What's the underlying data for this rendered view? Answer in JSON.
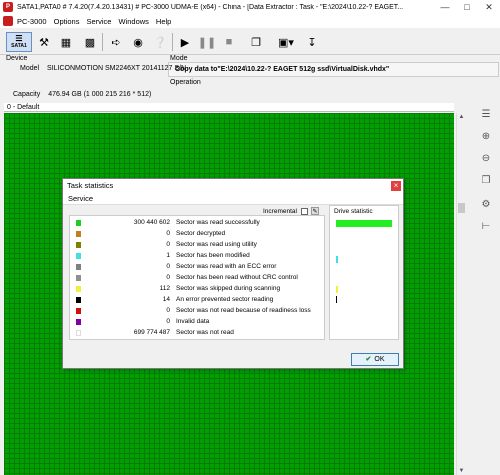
{
  "window": {
    "title": "SATA1,PATA0 # 7.4.20(7.4.20.13431) # PC-3000 UDMA-E (x64) - China - [Data Extractor : Task - \"E:\\2024\\10.22-? EAGET...",
    "app_name": "PC-3000"
  },
  "menu": {
    "items": [
      "Options",
      "Service",
      "Windows",
      "Help"
    ]
  },
  "toolbar": {
    "sata_label": "SATA1"
  },
  "device": {
    "section_label": "Device",
    "model_label": "Model",
    "model_value": "SILICONMOTION SM2246XT 20141127 S/N",
    "capacity_label": "Capacity",
    "capacity_value": "476.94 GB (1 000 215 216 * 512)"
  },
  "mode": {
    "section_label": "Mode",
    "value": "Copy data to\"E:\\2024\\10.22-? EAGET 512g ssd\\VirtualDisk.vhdx\"",
    "operation_label": "Operation"
  },
  "sector_map": {
    "header": "0 - Default"
  },
  "dialog": {
    "title": "Task statistics",
    "tab": "Service",
    "incremental_label": "Incremental",
    "drive_statistic_label": "Drive statistic",
    "ok_label": "OK",
    "stats": [
      {
        "color": "#22cc22",
        "value": "300 440 602",
        "desc": "Sector was read successfully"
      },
      {
        "color": "#c08020",
        "value": "0",
        "desc": "Sector decrypted"
      },
      {
        "color": "#808000",
        "value": "0",
        "desc": "Sector was read using utility"
      },
      {
        "color": "#40e0e0",
        "value": "1",
        "desc": "Sector has been modified"
      },
      {
        "color": "#808080",
        "value": "0",
        "desc": "Sector was read with an ECC error"
      },
      {
        "color": "#909090",
        "value": "0",
        "desc": "Sector has been read without CRC control"
      },
      {
        "color": "#f0f040",
        "value": "112",
        "desc": "Sector was skipped during scanning"
      },
      {
        "color": "#000000",
        "value": "14",
        "desc": "An error prevented sector reading"
      },
      {
        "color": "#d01010",
        "value": "0",
        "desc": "Sector was not read because of readiness loss"
      },
      {
        "color": "#8000a0",
        "value": "0",
        "desc": "Invalid data"
      },
      {
        "color": "#ffffff",
        "value": "699 774 487",
        "desc": "Sector was not read"
      }
    ]
  },
  "colors": {
    "sector_green": "#00a000",
    "drive_bar_success": "#22ee22"
  }
}
